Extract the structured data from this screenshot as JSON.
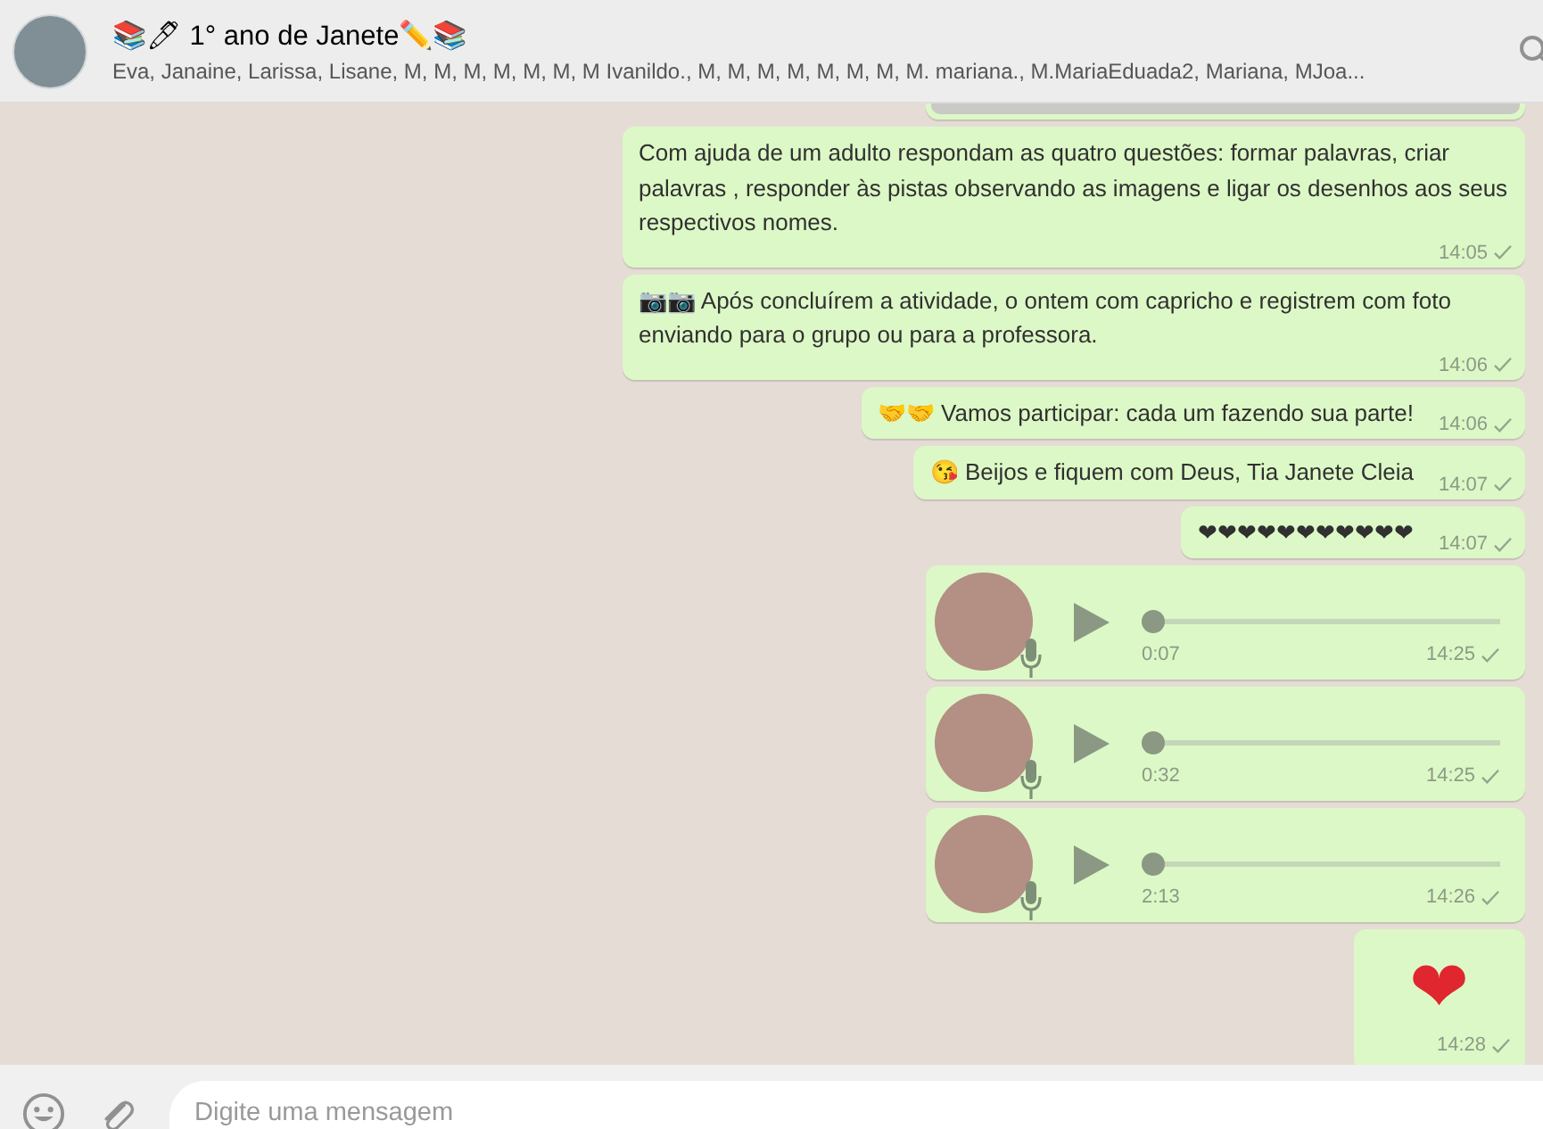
{
  "header": {
    "title": "📚🖊 1° ano de Janete✏️📚",
    "participants": "Eva, Janaine, Larissa, Lisane, M, M, M, M, M, M, M Ivanildo., M, M, M, M, M, M, M, M. mariana., M.MariaEduada2, Mariana, MJoa..."
  },
  "messages": [
    {
      "kind": "image"
    },
    {
      "kind": "text",
      "text": "Com ajuda de um adulto respondam as quatro questões: formar palavras, criar palavras , responder às pistas observando as imagens e ligar os desenhos aos seus respectivos nomes.",
      "time": "14:05"
    },
    {
      "kind": "text",
      "text": "📷📷 Após concluírem a atividade, o ontem com capricho e registrem com foto enviando para o grupo ou para a professora.",
      "time": "14:06"
    },
    {
      "kind": "text",
      "text": "🤝🤝 Vamos participar: cada um fazendo sua parte!",
      "time": "14:06"
    },
    {
      "kind": "text",
      "text": "😘 Beijos e fiquem com Deus, Tia Janete Cleia",
      "time": "14:07"
    },
    {
      "kind": "text",
      "text": "❤❤❤❤❤❤❤❤❤❤❤",
      "time": "14:07"
    },
    {
      "kind": "audio",
      "duration": "0:07",
      "level": 0,
      "time": "14:25"
    },
    {
      "kind": "audio",
      "duration": "0:32",
      "level": 0,
      "time": "14:25"
    },
    {
      "kind": "audio",
      "duration": "2:13",
      "level": 0,
      "time": "14:26"
    },
    {
      "kind": "emoji",
      "text": "❤",
      "time": "14:28"
    }
  ],
  "composer": {
    "placeholder": "Digite uma mensagem"
  }
}
